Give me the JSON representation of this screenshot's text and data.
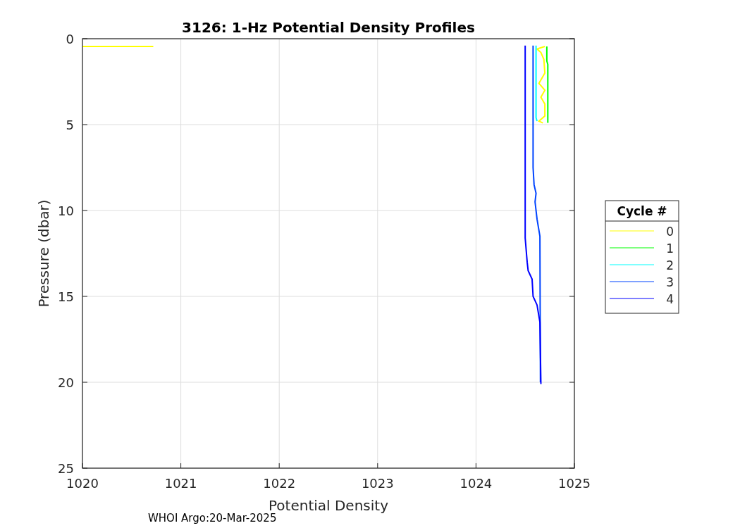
{
  "chart_data": {
    "type": "line",
    "title": "3126: 1-Hz Potential Density Profiles",
    "xlabel": "Potential Density",
    "ylabel": "Pressure (dbar)",
    "xlim": [
      1020,
      1025
    ],
    "ylim": [
      25,
      0
    ],
    "xticks": [
      1020,
      1021,
      1022,
      1023,
      1024,
      1025
    ],
    "yticks": [
      0,
      5,
      10,
      15,
      20,
      25
    ],
    "grid": true,
    "legend": {
      "title": "Cycle #"
    },
    "series": [
      {
        "name": "0",
        "color": "#ffff00",
        "x": [
          1020,
          1020.72,
          null,
          1024.7,
          1024.62,
          1024.66,
          1024.69,
          1024.7,
          1024.64,
          1024.7,
          1024.66,
          1024.7,
          1024.7,
          1024.64,
          1024.68
        ],
        "values": [
          0.45,
          0.45,
          null,
          0.45,
          0.6,
          0.8,
          1.2,
          2.0,
          2.6,
          3.0,
          3.4,
          3.8,
          4.5,
          4.8,
          4.9
        ]
      },
      {
        "name": "1",
        "color": "#00ff00",
        "x": [
          1024.72,
          1024.72,
          1024.73,
          1024.73
        ],
        "values": [
          0.45,
          1.3,
          1.5,
          4.9
        ]
      },
      {
        "name": "2",
        "color": "#00ffff",
        "x": [
          1024.61,
          1024.61,
          1024.62
        ],
        "values": [
          0.4,
          4.6,
          4.8
        ]
      },
      {
        "name": "3",
        "color": "#0044ff",
        "x": [
          1024.58,
          1024.58,
          1024.59,
          1024.61,
          1024.6,
          1024.62,
          1024.65,
          1024.655
        ],
        "values": [
          0.4,
          7.5,
          8.5,
          9.0,
          9.5,
          10.5,
          11.5,
          20.0
        ]
      },
      {
        "name": "4",
        "color": "#0000ff",
        "x": [
          1024.5,
          1024.5,
          1024.52,
          1024.53,
          1024.57,
          1024.58,
          1024.62,
          1024.65,
          1024.66
        ],
        "values": [
          0.4,
          11.6,
          13.0,
          13.5,
          14.0,
          15.0,
          15.5,
          16.5,
          20.1
        ]
      }
    ]
  },
  "footer": "WHOI Argo:20-Mar-2025"
}
